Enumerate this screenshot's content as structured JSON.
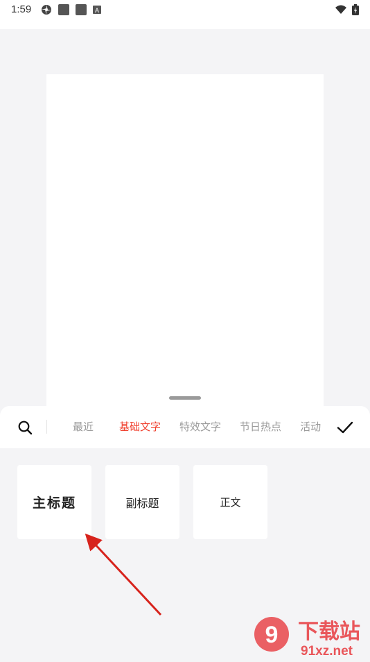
{
  "status_bar": {
    "time": "1:59",
    "icons": [
      "pinwheel-icon",
      "square-icon",
      "square-icon",
      "a-icon",
      "wifi-icon",
      "battery-icon"
    ],
    "a_icon_label": "A"
  },
  "tabs": {
    "items": [
      {
        "label": "最近",
        "active": false
      },
      {
        "label": "基础文字",
        "active": true
      },
      {
        "label": "特效文字",
        "active": false
      },
      {
        "label": "节日热点",
        "active": false
      },
      {
        "label": "活动",
        "active": false
      }
    ],
    "active_color": "#f0412f"
  },
  "cards": [
    {
      "label": "主标题"
    },
    {
      "label": "副标题"
    },
    {
      "label": "正文"
    }
  ],
  "watermark": {
    "brand": "下载站",
    "domain": "91xz.net",
    "logo_text": "9"
  }
}
